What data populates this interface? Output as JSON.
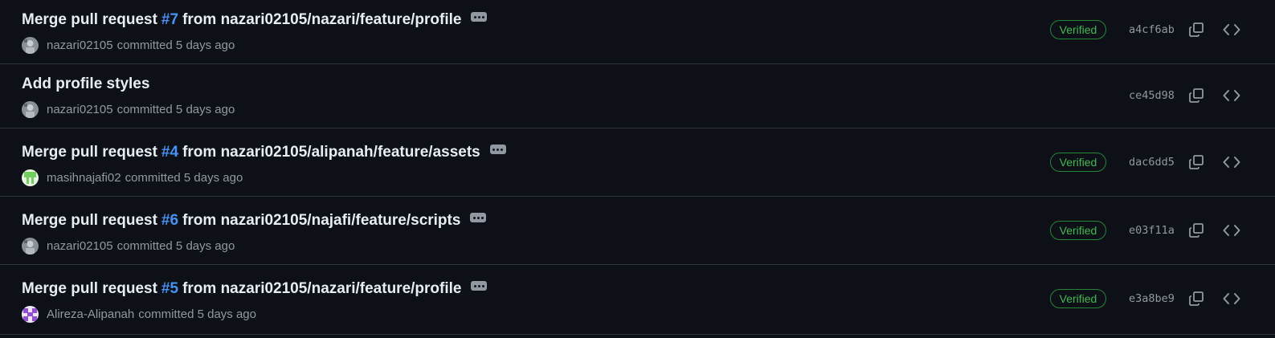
{
  "commits": [
    {
      "title_before": "Merge pull request",
      "pr_number": "#7",
      "title_after": "from nazari02105/nazari/feature/profile",
      "has_ellipsis": true,
      "author": "nazari02105",
      "committed_text": "committed 5 days ago",
      "avatar": "avatar-gray",
      "verified": true,
      "verified_label": "Verified",
      "sha": "a4cf6ab"
    },
    {
      "title_before": "Add profile styles",
      "pr_number": "",
      "title_after": "",
      "has_ellipsis": false,
      "author": "nazari02105",
      "committed_text": "committed 5 days ago",
      "avatar": "avatar-gray",
      "verified": false,
      "verified_label": "",
      "sha": "ce45d98"
    },
    {
      "title_before": "Merge pull request",
      "pr_number": "#4",
      "title_after": "from nazari02105/alipanah/feature/assets",
      "has_ellipsis": true,
      "author": "masihnajafi02",
      "committed_text": "committed 5 days ago",
      "avatar": "avatar-green",
      "verified": true,
      "verified_label": "Verified",
      "sha": "dac6dd5"
    },
    {
      "title_before": "Merge pull request",
      "pr_number": "#6",
      "title_after": "from nazari02105/najafi/feature/scripts",
      "has_ellipsis": true,
      "author": "nazari02105",
      "committed_text": "committed 5 days ago",
      "avatar": "avatar-gray",
      "verified": true,
      "verified_label": "Verified",
      "sha": "e03f11a"
    },
    {
      "title_before": "Merge pull request",
      "pr_number": "#5",
      "title_after": "from nazari02105/nazari/feature/profile",
      "has_ellipsis": true,
      "author": "Alireza-Alipanah",
      "committed_text": "committed 5 days ago",
      "avatar": "avatar-purple",
      "verified": true,
      "verified_label": "Verified",
      "sha": "e3a8be9"
    }
  ],
  "icons": {
    "copy": "copy-icon",
    "browse": "code-brackets-icon",
    "ellipsis": "ellipsis-icon"
  },
  "colors": {
    "background": "#0d1117",
    "pr_link": "#4493f8",
    "verified": "#3fb950",
    "muted": "#9198a1"
  }
}
